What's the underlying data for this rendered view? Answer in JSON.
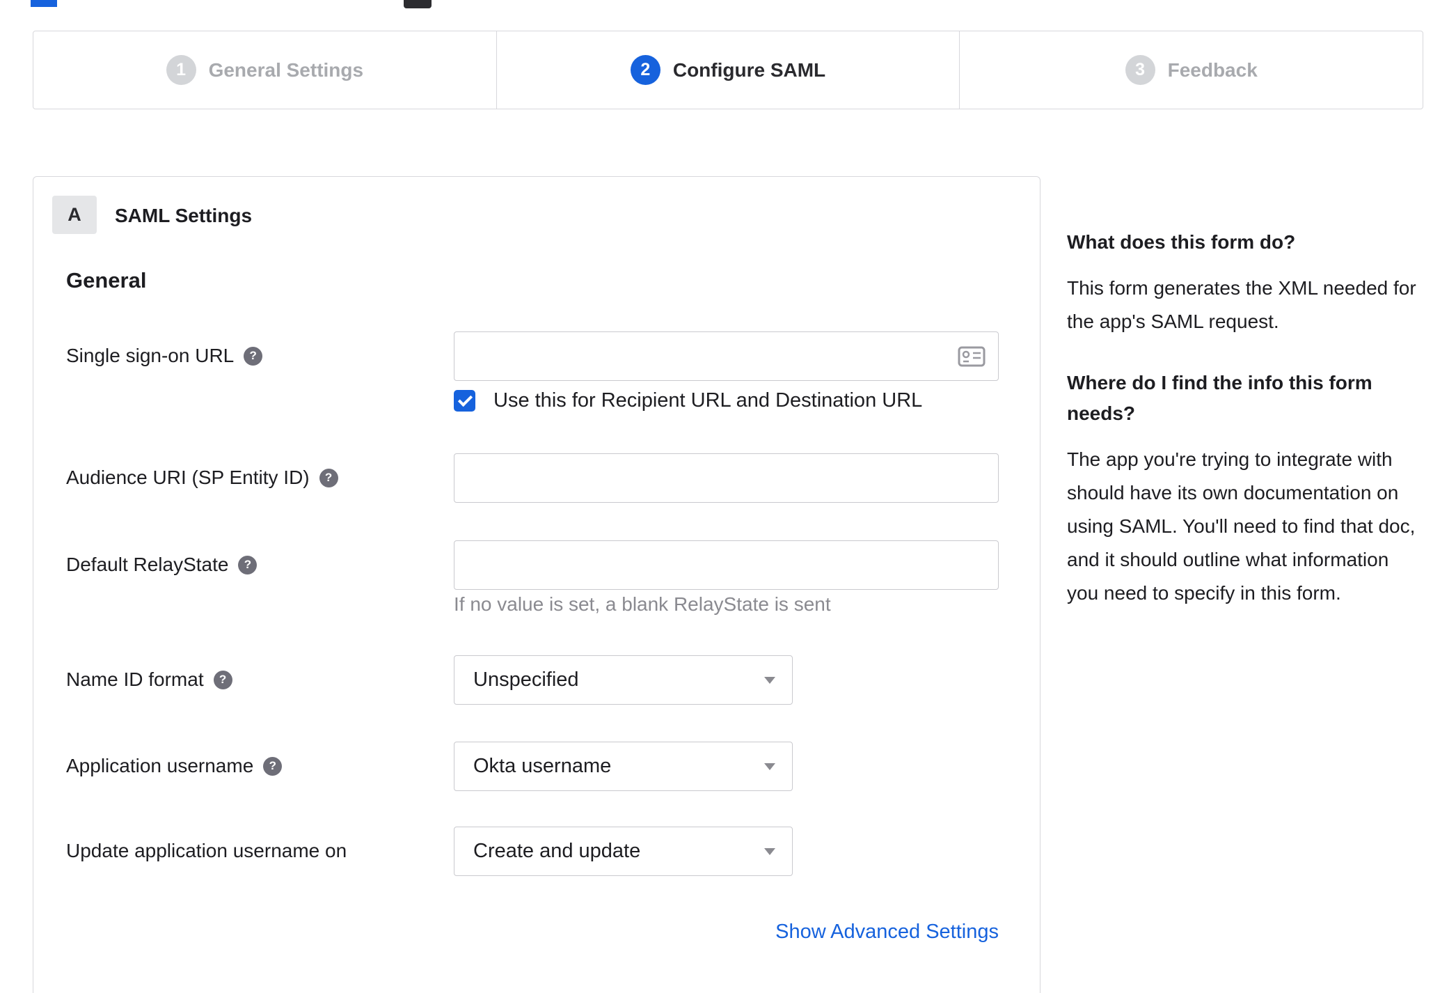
{
  "stepper": {
    "steps": [
      {
        "number": "1",
        "label": "General Settings",
        "state": "inactive"
      },
      {
        "number": "2",
        "label": "Configure SAML",
        "state": "active"
      },
      {
        "number": "3",
        "label": "Feedback",
        "state": "inactive"
      }
    ]
  },
  "form": {
    "badge": "A",
    "section_title": "SAML Settings",
    "group_title": "General",
    "help_glyph": "?",
    "sso": {
      "label": "Single sign-on URL",
      "value": "",
      "checkbox_label": "Use this for Recipient URL and Destination URL",
      "checked": true
    },
    "audience": {
      "label": "Audience URI (SP Entity ID)",
      "value": ""
    },
    "relay": {
      "label": "Default RelayState",
      "value": "",
      "hint": "If no value is set, a blank RelayState is sent"
    },
    "name_id": {
      "label": "Name ID format",
      "value": "Unspecified"
    },
    "app_username": {
      "label": "Application username",
      "value": "Okta username"
    },
    "update_username": {
      "label": "Update application username on",
      "value": "Create and update"
    },
    "advanced_link": "Show Advanced Settings"
  },
  "sidebar": {
    "q1": "What does this form do?",
    "a1": "This form generates the XML needed for the app's SAML request.",
    "q2": "Where do I find the info this form needs?",
    "a2": "The app you're trying to integrate with should have its own documentation on using SAML. You'll need to find that doc, and it should outline what information you need to specify in this form."
  },
  "colors": {
    "accent": "#1662dd",
    "link": "#1662dd",
    "inactive_gray": "#a8aaae"
  }
}
